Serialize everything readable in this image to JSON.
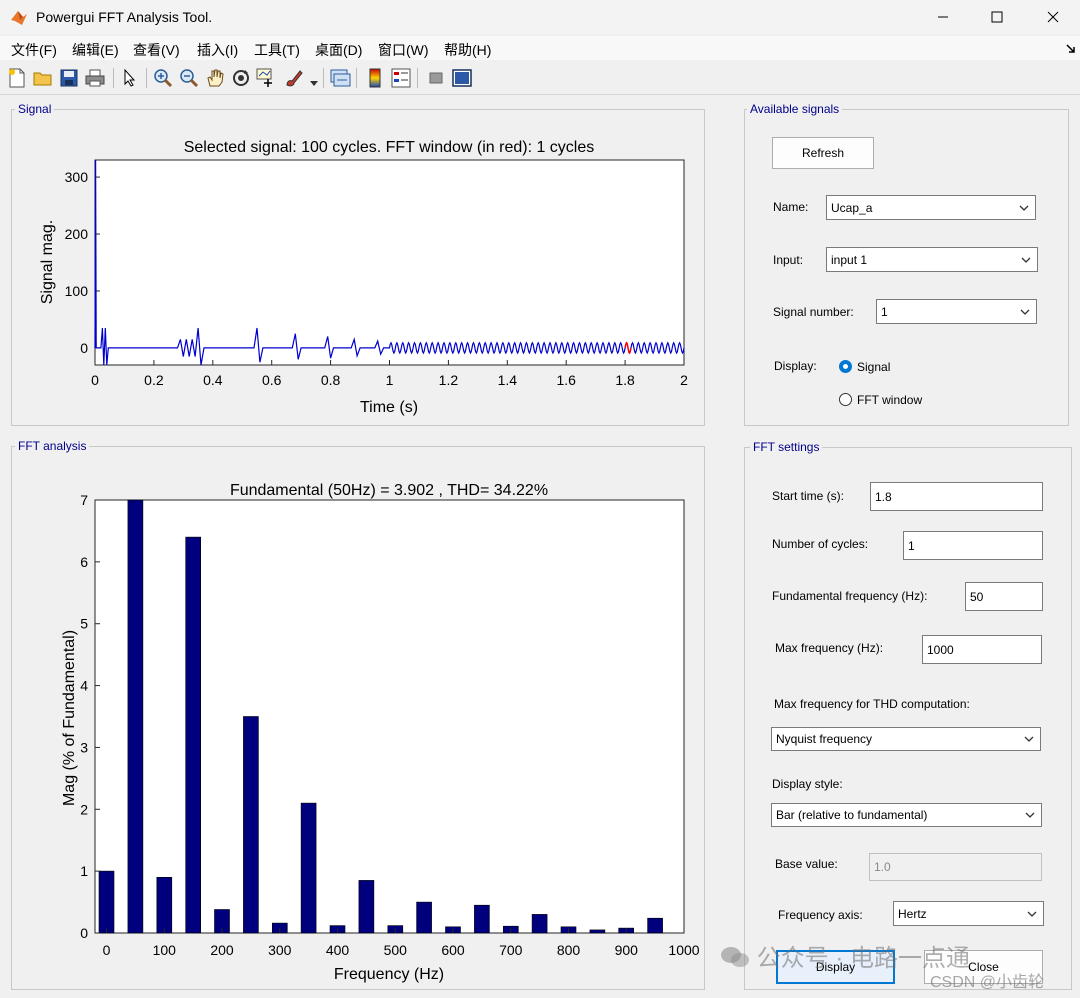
{
  "window": {
    "title": "Powergui FFT Analysis Tool."
  },
  "menu": [
    "文件(F)",
    "编辑(E)",
    "查看(V)",
    "插入(I)",
    "工具(T)",
    "桌面(D)",
    "窗口(W)",
    "帮助(H)"
  ],
  "toolbar_icons": [
    "new-file-icon",
    "open-folder-icon",
    "save-icon",
    "print-icon",
    "pointer-icon",
    "zoom-in-icon",
    "zoom-out-icon",
    "pan-hand-icon",
    "rotate-3d-icon",
    "data-cursor-icon",
    "brush-icon",
    "link-icon",
    "colorbar-icon",
    "legend-icon",
    "hide-plot-tools-icon",
    "show-plot-tools-icon"
  ],
  "signal_panel": {
    "title": "Signal"
  },
  "fft_panel": {
    "title": "FFT analysis"
  },
  "available_signals": {
    "title": "Available signals",
    "refresh_label": "Refresh",
    "name_label": "Name:",
    "name_value": "Ucap_a",
    "input_label": "Input:",
    "input_value": "input 1",
    "signal_number_label": "Signal number:",
    "signal_number_value": "1",
    "display_label": "Display:",
    "display_options": [
      "Signal",
      "FFT window"
    ],
    "display_selected": "Signal"
  },
  "fft_settings": {
    "title": "FFT settings",
    "start_time_label": "Start time (s):",
    "start_time_value": "1.8",
    "cycles_label": "Number of cycles:",
    "cycles_value": "1",
    "fund_freq_label": "Fundamental frequency (Hz):",
    "fund_freq_value": "50",
    "max_freq_label": "Max frequency (Hz):",
    "max_freq_value": "1000",
    "thd_label": "Max frequency for THD computation:",
    "thd_value": "Nyquist frequency",
    "display_style_label": "Display style:",
    "display_style_value": "Bar (relative to fundamental)",
    "base_value_label": "Base value:",
    "base_value": "1.0",
    "freq_axis_label": "Frequency axis:",
    "freq_axis_value": "Hertz",
    "display_button": "Display",
    "close_button": "Close"
  },
  "watermark": {
    "text1": "公众号 · 电路一点通",
    "text2": "CSDN @小齿轮"
  },
  "colors": {
    "signal": "#0000cd",
    "fft_window": "#ff0000",
    "bars": "#00007f",
    "panel_title": "#00008b",
    "radio": "#0078d4"
  },
  "chart_data": [
    {
      "type": "line",
      "title": "Selected signal: 100 cycles. FFT window (in red): 1 cycles",
      "xlabel": "Time (s)",
      "ylabel": "Signal mag.",
      "xlim": [
        0,
        2
      ],
      "ylim": [
        -30,
        330
      ],
      "xticks": [
        "0",
        "0.2",
        "0.4",
        "0.6",
        "0.8",
        "1",
        "1.2",
        "1.4",
        "1.6",
        "1.8",
        "2"
      ],
      "yticks": [
        "0",
        "100",
        "200",
        "300"
      ],
      "series": [
        {
          "values": [
            [
              0.0,
              0
            ],
            [
              0.002,
              330
            ],
            [
              0.004,
              0
            ],
            [
              0.02,
              0
            ],
            [
              0.025,
              35
            ],
            [
              0.03,
              -30
            ],
            [
              0.035,
              35
            ],
            [
              0.04,
              -30
            ],
            [
              0.045,
              0
            ],
            [
              0.28,
              0
            ],
            [
              0.29,
              15
            ],
            [
              0.3,
              -15
            ],
            [
              0.31,
              15
            ],
            [
              0.32,
              -15
            ],
            [
              0.33,
              15
            ],
            [
              0.34,
              -15
            ],
            [
              0.35,
              35
            ],
            [
              0.36,
              -30
            ],
            [
              0.37,
              0
            ],
            [
              0.54,
              0
            ],
            [
              0.55,
              35
            ],
            [
              0.56,
              -25
            ],
            [
              0.57,
              0
            ],
            [
              0.67,
              0
            ],
            [
              0.68,
              25
            ],
            [
              0.69,
              -20
            ],
            [
              0.7,
              0
            ],
            [
              0.78,
              0
            ],
            [
              0.79,
              20
            ],
            [
              0.8,
              -18
            ],
            [
              0.81,
              0
            ],
            [
              0.87,
              0
            ],
            [
              0.88,
              15
            ],
            [
              0.89,
              -14
            ],
            [
              0.9,
              0
            ],
            [
              0.95,
              0
            ],
            [
              0.96,
              12
            ],
            [
              0.97,
              -11
            ],
            [
              0.98,
              0
            ]
          ]
        },
        {
          "values": [
            [
              1.8,
              0
            ],
            [
              1.82,
              0
            ]
          ]
        }
      ],
      "steady_oscillation": {
        "start": 1.0,
        "end": 2.0,
        "amplitude": 9,
        "frequency_hz": 50
      }
    },
    {
      "type": "bar",
      "title": "Fundamental (50Hz) = 3.902 , THD= 34.22%",
      "xlabel": "Frequency (Hz)",
      "ylabel": "Mag (% of Fundamental)",
      "xlim": [
        -20,
        1000
      ],
      "ylim": [
        0,
        7
      ],
      "xticks": [
        "0",
        "100",
        "200",
        "300",
        "400",
        "500",
        "600",
        "700",
        "800",
        "900",
        "1000"
      ],
      "yticks": [
        "0",
        "1",
        "2",
        "3",
        "4",
        "5",
        "6",
        "7"
      ],
      "x": [
        0,
        50,
        100,
        150,
        200,
        250,
        300,
        350,
        400,
        450,
        500,
        550,
        600,
        650,
        700,
        750,
        800,
        850,
        900,
        950
      ],
      "values": [
        1.0,
        7.0,
        0.9,
        6.4,
        0.38,
        3.5,
        0.16,
        2.1,
        0.12,
        0.85,
        0.12,
        0.5,
        0.1,
        0.45,
        0.11,
        0.3,
        0.1,
        0.05,
        0.08,
        0.24
      ]
    }
  ]
}
